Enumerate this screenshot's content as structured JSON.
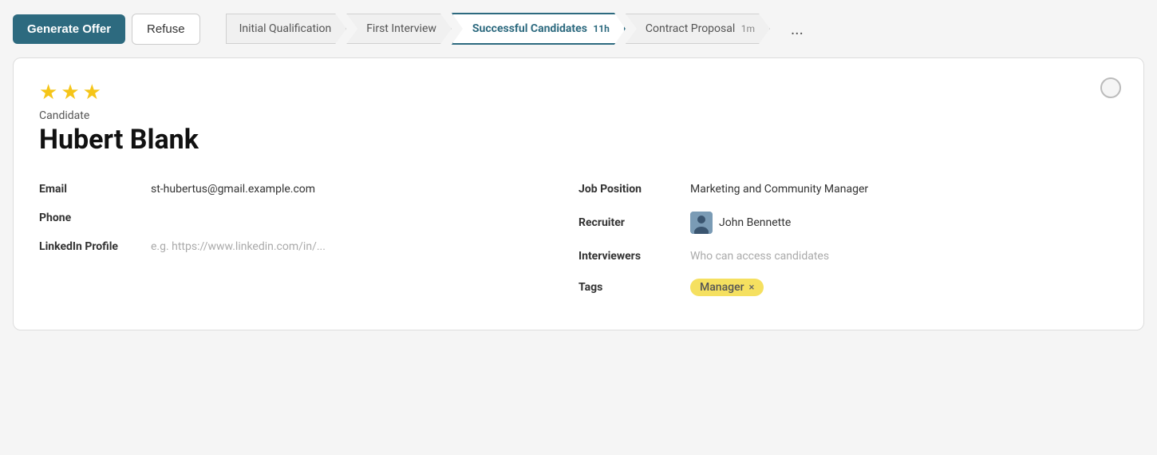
{
  "toolbar": {
    "generate_label": "Generate Offer",
    "refuse_label": "Refuse"
  },
  "pipeline": {
    "stages": [
      {
        "id": "initial-qualification",
        "label": "Initial Qualification",
        "badge": "",
        "active": false
      },
      {
        "id": "first-interview",
        "label": "First Interview",
        "badge": "",
        "active": false
      },
      {
        "id": "successful-candidates",
        "label": "Successful Candidates",
        "badge": "11h",
        "active": true
      },
      {
        "id": "contract-proposal",
        "label": "Contract Proposal",
        "badge": "1m",
        "active": false
      }
    ],
    "more_label": "..."
  },
  "card": {
    "stars": 3,
    "max_stars": 3,
    "candidate_label": "Candidate",
    "candidate_name": "Hubert Blank",
    "radio_label": "",
    "fields_left": [
      {
        "label": "Email",
        "value": "st-hubertus@gmail.example.com",
        "placeholder": false
      },
      {
        "label": "Phone",
        "value": "",
        "placeholder": false
      },
      {
        "label": "LinkedIn Profile",
        "value": "e.g. https://www.linkedin.com/in/...",
        "placeholder": true
      }
    ],
    "fields_right": [
      {
        "label": "Job Position",
        "value": "Marketing and Community Manager",
        "placeholder": false
      },
      {
        "label": "Recruiter",
        "value": "John Bennette",
        "placeholder": false,
        "has_avatar": true
      },
      {
        "label": "Interviewers",
        "value": "Who can access candidates",
        "placeholder": true
      },
      {
        "label": "Tags",
        "value": "",
        "placeholder": false,
        "has_tag": true
      }
    ],
    "tag_label": "Manager",
    "tag_close": "×"
  }
}
